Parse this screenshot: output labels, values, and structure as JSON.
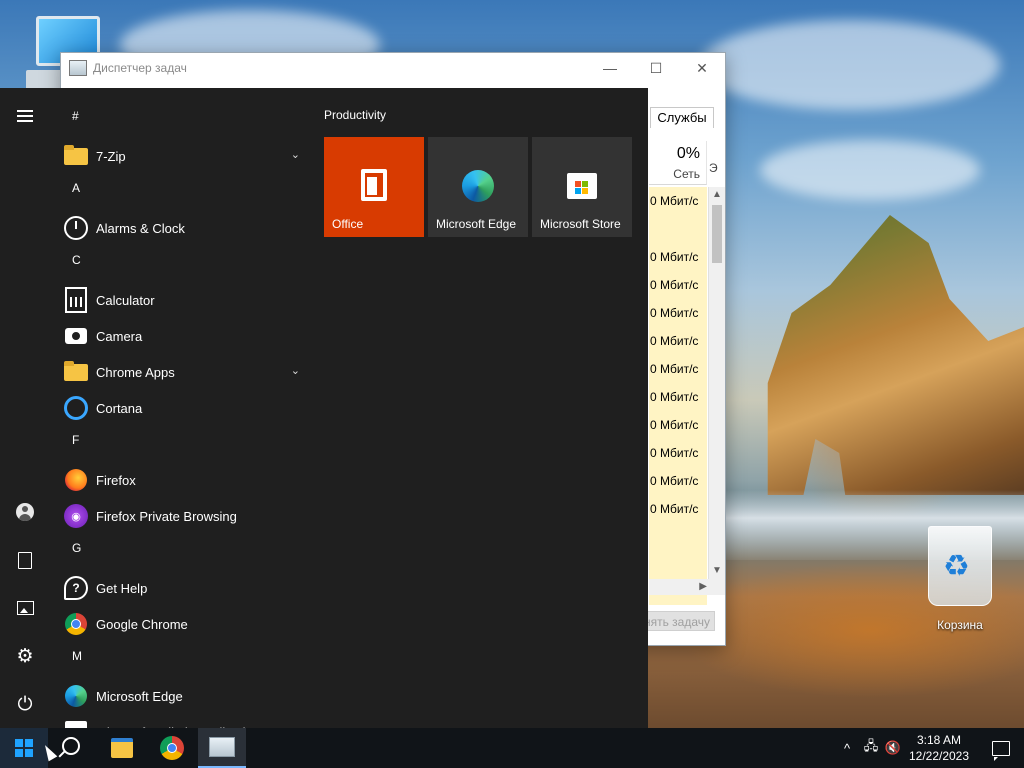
{
  "desktop": {
    "recycle_bin_label": "Корзина"
  },
  "task_manager": {
    "title": "Диспетчер задач",
    "controls": {
      "minimize": "—",
      "maximize": "☐",
      "close": "✕"
    },
    "tab_visible": "Службы",
    "network_column": {
      "percent": "0%",
      "name": "Сеть"
    },
    "next_column_letter": "Э",
    "rows": [
      "0 Мбит/с",
      "",
      "0 Мбит/с",
      "0 Мбит/с",
      "0 Мбит/с",
      "0 Мбит/с",
      "0 Мбит/с",
      "0 Мбит/с",
      "0 Мбит/с",
      "0 Мбит/с",
      "0 Мбит/с",
      "0 Мбит/с"
    ],
    "end_task_label": "нять задачу"
  },
  "start_menu": {
    "apps": [
      {
        "type": "letter",
        "label": "#"
      },
      {
        "type": "app",
        "label": "7-Zip",
        "icon": "folder-icon",
        "expandable": true
      },
      {
        "type": "letter",
        "label": "A"
      },
      {
        "type": "app",
        "label": "Alarms & Clock",
        "icon": "clock-icon"
      },
      {
        "type": "letter",
        "label": "C"
      },
      {
        "type": "app",
        "label": "Calculator",
        "icon": "calculator-icon"
      },
      {
        "type": "app",
        "label": "Camera",
        "icon": "camera-icon"
      },
      {
        "type": "app",
        "label": "Chrome Apps",
        "icon": "folder-icon",
        "expandable": true
      },
      {
        "type": "app",
        "label": "Cortana",
        "icon": "cortana-icon"
      },
      {
        "type": "letter",
        "label": "F"
      },
      {
        "type": "app",
        "label": "Firefox",
        "icon": "firefox-icon"
      },
      {
        "type": "app",
        "label": "Firefox Private Browsing",
        "icon": "firefox-private-icon"
      },
      {
        "type": "letter",
        "label": "G"
      },
      {
        "type": "app",
        "label": "Get Help",
        "icon": "help-icon"
      },
      {
        "type": "app",
        "label": "Google Chrome",
        "icon": "chrome-icon"
      },
      {
        "type": "letter",
        "label": "M"
      },
      {
        "type": "app",
        "label": "Microsoft Edge",
        "icon": "edge-icon"
      },
      {
        "type": "app",
        "label": "Microsoft Solitaire Collection",
        "icon": "solitaire-icon"
      }
    ],
    "tiles_group": "Productivity",
    "tiles": [
      {
        "label": "Office",
        "icon": "office-icon"
      },
      {
        "label": "Microsoft Edge",
        "icon": "edge-icon"
      },
      {
        "label": "Microsoft Store",
        "icon": "store-icon"
      }
    ],
    "accent_color": "#d83b01"
  },
  "taskbar": {
    "tray_chevron": "^",
    "clock_time": "3:18 AM",
    "clock_date": "12/22/2023",
    "accent_color": "#1fa3ff"
  }
}
